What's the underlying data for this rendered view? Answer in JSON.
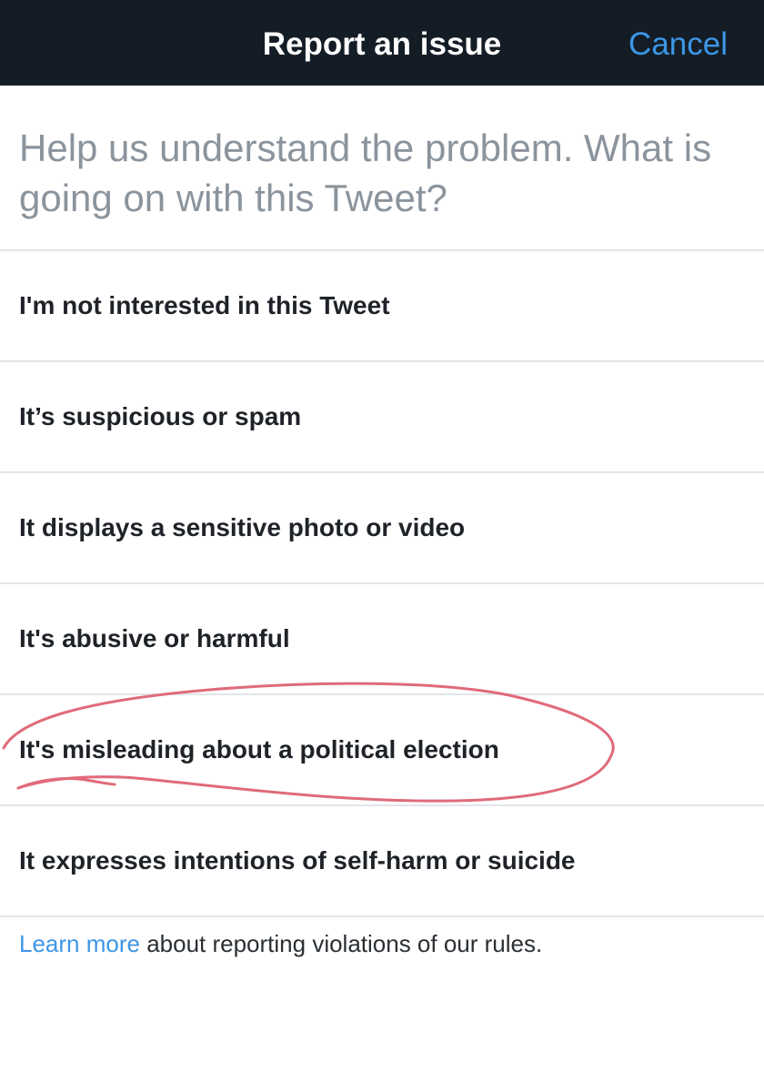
{
  "header": {
    "title": "Report an issue",
    "cancel_label": "Cancel"
  },
  "prompt": "Help us understand the problem. What is going on with this Tweet?",
  "options": [
    {
      "label": "I'm not interested in this Tweet"
    },
    {
      "label": "It’s suspicious or spam"
    },
    {
      "label": "It displays a sensitive photo or video"
    },
    {
      "label": "It's abusive or harmful"
    },
    {
      "label": "It's misleading about a political election"
    },
    {
      "label": "It expresses intentions of self-harm or suicide"
    }
  ],
  "footer": {
    "link_label": "Learn more",
    "text": " about reporting violations of our rules."
  },
  "colors": {
    "navbar": "#141d26",
    "accent": "#3d96e6",
    "annotation": "#e06a7a"
  }
}
